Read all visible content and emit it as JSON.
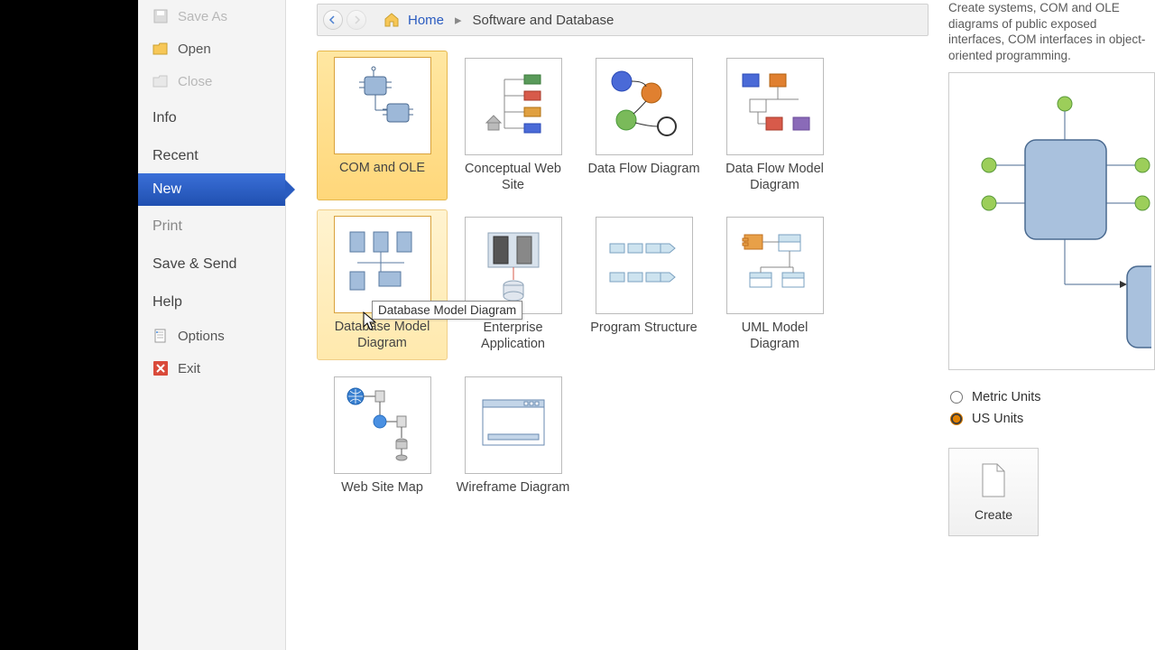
{
  "sidebar": {
    "saveAs": "Save As",
    "open": "Open",
    "close": "Close",
    "info": "Info",
    "recent": "Recent",
    "new": "New",
    "print": "Print",
    "saveSend": "Save & Send",
    "help": "Help",
    "options": "Options",
    "exit": "Exit"
  },
  "breadcrumb": {
    "home": "Home",
    "category": "Software and Database"
  },
  "templates": [
    {
      "label": "COM and OLE",
      "selected": true
    },
    {
      "label": "Conceptual Web Site"
    },
    {
      "label": "Data Flow Diagram"
    },
    {
      "label": "Data Flow Model Diagram"
    },
    {
      "label": "Database Model Diagram",
      "hover": true,
      "tooltip": "Database Model Diagram"
    },
    {
      "label": "Enterprise Application"
    },
    {
      "label": "Program Structure"
    },
    {
      "label": "UML Model Diagram"
    },
    {
      "label": "Web Site Map"
    },
    {
      "label": "Wireframe Diagram"
    }
  ],
  "tooltip": "Database Model Diagram",
  "rightPanel": {
    "description": "Create systems, COM and OLE diagrams of public exposed interfaces, COM interfaces in object-oriented programming.",
    "metric": "Metric Units",
    "us": "US Units",
    "create": "Create"
  }
}
